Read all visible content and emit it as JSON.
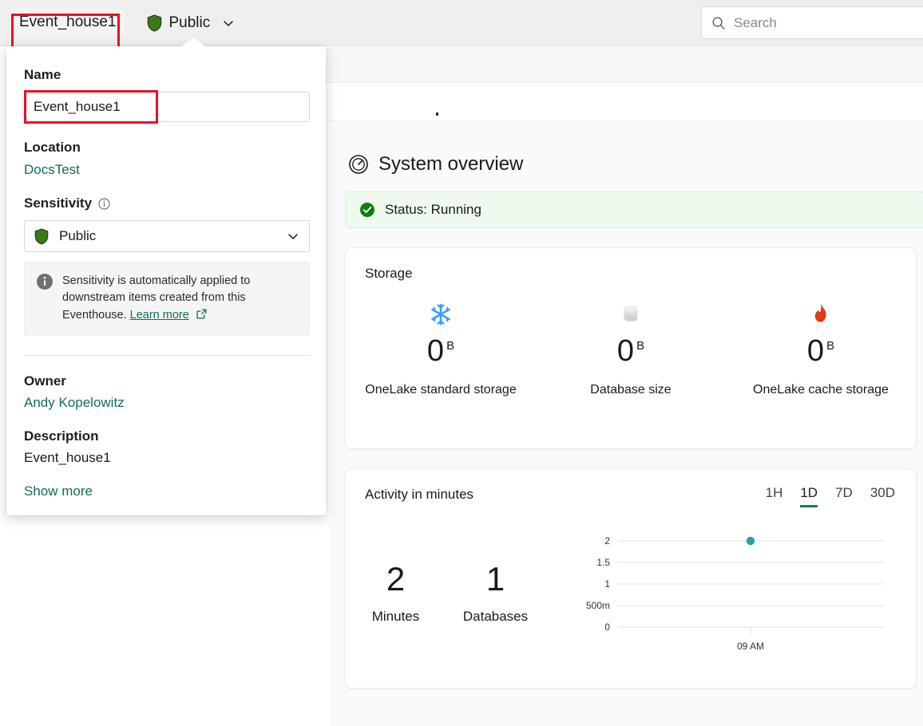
{
  "topbar": {
    "item_title": "Event_house1",
    "sensitivity_chip": {
      "label": "Public",
      "shield_icon": "shield-icon",
      "chevron_icon": "chevron-down-icon"
    },
    "search": {
      "placeholder": "Search",
      "icon": "search-icon"
    }
  },
  "popover": {
    "name": {
      "label": "Name",
      "value": "Event_house1"
    },
    "location": {
      "label": "Location",
      "value": "DocsTest"
    },
    "sensitivity": {
      "label": "Sensitivity",
      "info_icon": "info-circle-icon",
      "selected": "Public",
      "shield_icon": "shield-icon",
      "chevron_icon": "chevron-down-icon",
      "notice": {
        "icon": "info-filled-icon",
        "text": "Sensitivity is automatically applied to downstream items created from this Eventhouse.",
        "link_label": "Learn more",
        "external_icon": "open-in-new-icon"
      }
    },
    "owner": {
      "label": "Owner",
      "value": "Andy Kopelowitz"
    },
    "description": {
      "label": "Description",
      "value": "Event_house1"
    },
    "show_more_label": "Show more"
  },
  "main": {
    "section": {
      "icon": "gauge-icon",
      "title": "System overview"
    },
    "status": {
      "icon": "check-circle-icon",
      "text": "Status: Running"
    },
    "storage": {
      "title": "Storage",
      "items": [
        {
          "icon": "snowflake-icon",
          "value": "0",
          "unit": "B",
          "label": "OneLake standard storage"
        },
        {
          "icon": "database-icon",
          "value": "0",
          "unit": "B",
          "label": "Database size"
        },
        {
          "icon": "flame-icon",
          "value": "0",
          "unit": "B",
          "label": "OneLake cache storage"
        }
      ]
    },
    "activity": {
      "title": "Activity in minutes",
      "ranges": [
        {
          "label": "1H",
          "active": false
        },
        {
          "label": "1D",
          "active": true
        },
        {
          "label": "7D",
          "active": false
        },
        {
          "label": "30D",
          "active": false
        }
      ],
      "kpis": [
        {
          "value": "2",
          "label": "Minutes"
        },
        {
          "value": "1",
          "label": "Databases"
        }
      ]
    }
  },
  "chart_data": {
    "type": "scatter",
    "title": "Activity in minutes",
    "xlabel": "",
    "ylabel": "",
    "x": [
      "09 AM"
    ],
    "values": [
      2
    ],
    "ytick_labels": [
      "0",
      "500m",
      "1",
      "1.5",
      "2"
    ],
    "ytick_values": [
      0,
      0.5,
      1,
      1.5,
      2
    ],
    "xtick_labels": [
      "09 AM"
    ],
    "ylim": [
      0,
      2
    ],
    "grid": true,
    "legend": "none",
    "point_color": "#29a397"
  },
  "colors": {
    "accent_teal": "#0f7b6c",
    "link_green": "#0f6c5c",
    "highlight_red": "#e81123",
    "status_green": "#107c10",
    "snowflake_blue": "#3aa0f3",
    "flame_red": "#e23b14",
    "shield_green": "#3b7a15"
  }
}
